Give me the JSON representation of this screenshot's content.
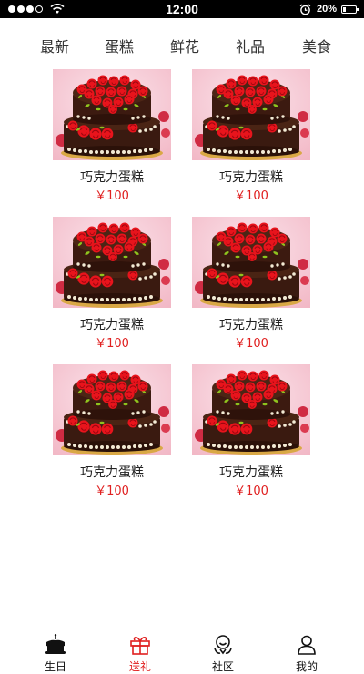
{
  "status_bar": {
    "time": "12:00",
    "battery": "20%",
    "battery_level": 0.2,
    "signal_bars": 3,
    "icons": [
      "signal-icon",
      "wifi-icon",
      "alarm-icon",
      "battery-icon"
    ]
  },
  "categories": [
    "最新",
    "蛋糕",
    "鲜花",
    "礼品",
    "美食"
  ],
  "products": [
    {
      "name": "巧克力蛋糕",
      "price": "￥100",
      "image": "chocolate-rose-cake"
    },
    {
      "name": "巧克力蛋糕",
      "price": "￥100",
      "image": "chocolate-rose-cake"
    },
    {
      "name": "巧克力蛋糕",
      "price": "￥100",
      "image": "chocolate-rose-cake"
    },
    {
      "name": "巧克力蛋糕",
      "price": "￥100",
      "image": "chocolate-rose-cake"
    },
    {
      "name": "巧克力蛋糕",
      "price": "￥100",
      "image": "chocolate-rose-cake"
    },
    {
      "name": "巧克力蛋糕",
      "price": "￥100",
      "image": "chocolate-rose-cake"
    }
  ],
  "tabs": [
    {
      "label": "生日",
      "icon": "cake-icon",
      "active": false
    },
    {
      "label": "送礼",
      "icon": "gift-icon",
      "active": true
    },
    {
      "label": "社区",
      "icon": "community-icon",
      "active": false
    },
    {
      "label": "我的",
      "icon": "user-icon",
      "active": false
    }
  ],
  "colors": {
    "accent": "#e02020",
    "text": "#222222",
    "status_bar_bg": "#000000",
    "divider": "#e3e3e3"
  }
}
